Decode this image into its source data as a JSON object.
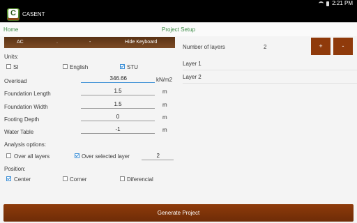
{
  "status": {
    "time": "2:21 PM"
  },
  "app": {
    "title": "CASENT"
  },
  "nav": {
    "home": "Home",
    "page_title": "Project Setup"
  },
  "keyboard_bar": {
    "keys": [
      "AC",
      ".",
      "-"
    ],
    "hide_label": "Hide Keyboard"
  },
  "units": {
    "label": "Units:",
    "options": [
      {
        "label": "SI",
        "checked": false
      },
      {
        "label": "English",
        "checked": false
      },
      {
        "label": "STU",
        "checked": true
      }
    ]
  },
  "fields": {
    "overload": {
      "label": "Overload",
      "value": "346.66",
      "unit": "kN/m2"
    },
    "foundation_length": {
      "label": "Foundation Length",
      "value": "1.5",
      "unit": "m"
    },
    "foundation_width": {
      "label": "Foundation Width",
      "value": "1.5",
      "unit": "m"
    },
    "footing_depth": {
      "label": "Footing Depth",
      "value": "0",
      "unit": "m"
    },
    "water_table": {
      "label": "Water Table",
      "value": "-1",
      "unit": "m"
    }
  },
  "analysis": {
    "label": "Analysis options:",
    "over_all": {
      "label": "Over all layers",
      "checked": false
    },
    "over_selected": {
      "label": "Over selected layer",
      "checked": true
    },
    "selected_layer": "2"
  },
  "position": {
    "label": "Position:",
    "options": [
      {
        "label": "Center",
        "checked": true
      },
      {
        "label": "Corner",
        "checked": false
      },
      {
        "label": "Diferencial",
        "checked": false
      }
    ]
  },
  "layers": {
    "label": "Number of layers",
    "count": "2",
    "add": "+",
    "remove": "-",
    "items": [
      "Layer 1",
      "Layer 2"
    ]
  },
  "generate_label": "Generate Project",
  "colors": {
    "accent_green": "#3a8a44",
    "brand_brown": "#8f3a0b",
    "check_blue": "#3c8fd6"
  }
}
